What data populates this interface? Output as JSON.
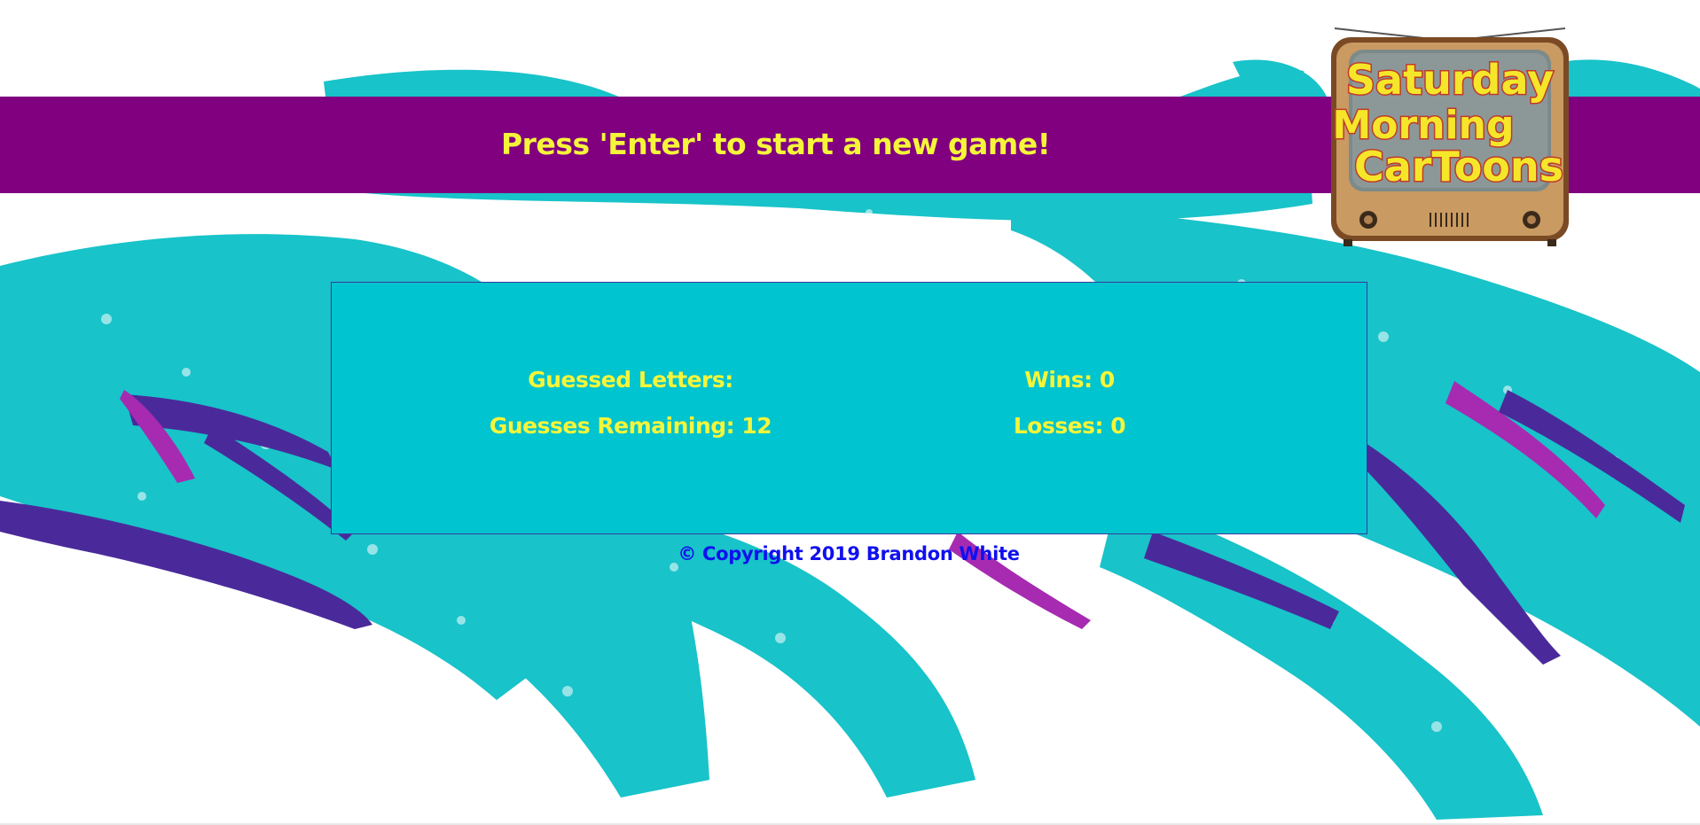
{
  "header": {
    "prompt": "Press 'Enter' to start a new game!"
  },
  "logo": {
    "line1": "Saturday",
    "line2": "Morning",
    "line3": "CarToons"
  },
  "stats": {
    "guessed_letters_label": "Guessed Letters:",
    "guesses_remaining_label": "Guesses Remaining: 12",
    "wins_label": "Wins: 0",
    "losses_label": "Losses: 0"
  },
  "footer": {
    "copyright": "© Copyright 2019 Brandon White"
  },
  "colors": {
    "header_band": "#800080",
    "accent_yellow": "#f5f53a",
    "panel_teal": "#00c4cf",
    "splash_teal": "#18c3c9",
    "splash_purple": "#4a2a9a",
    "splash_magenta": "#a62bb0",
    "footer_blue": "#1010ee"
  }
}
